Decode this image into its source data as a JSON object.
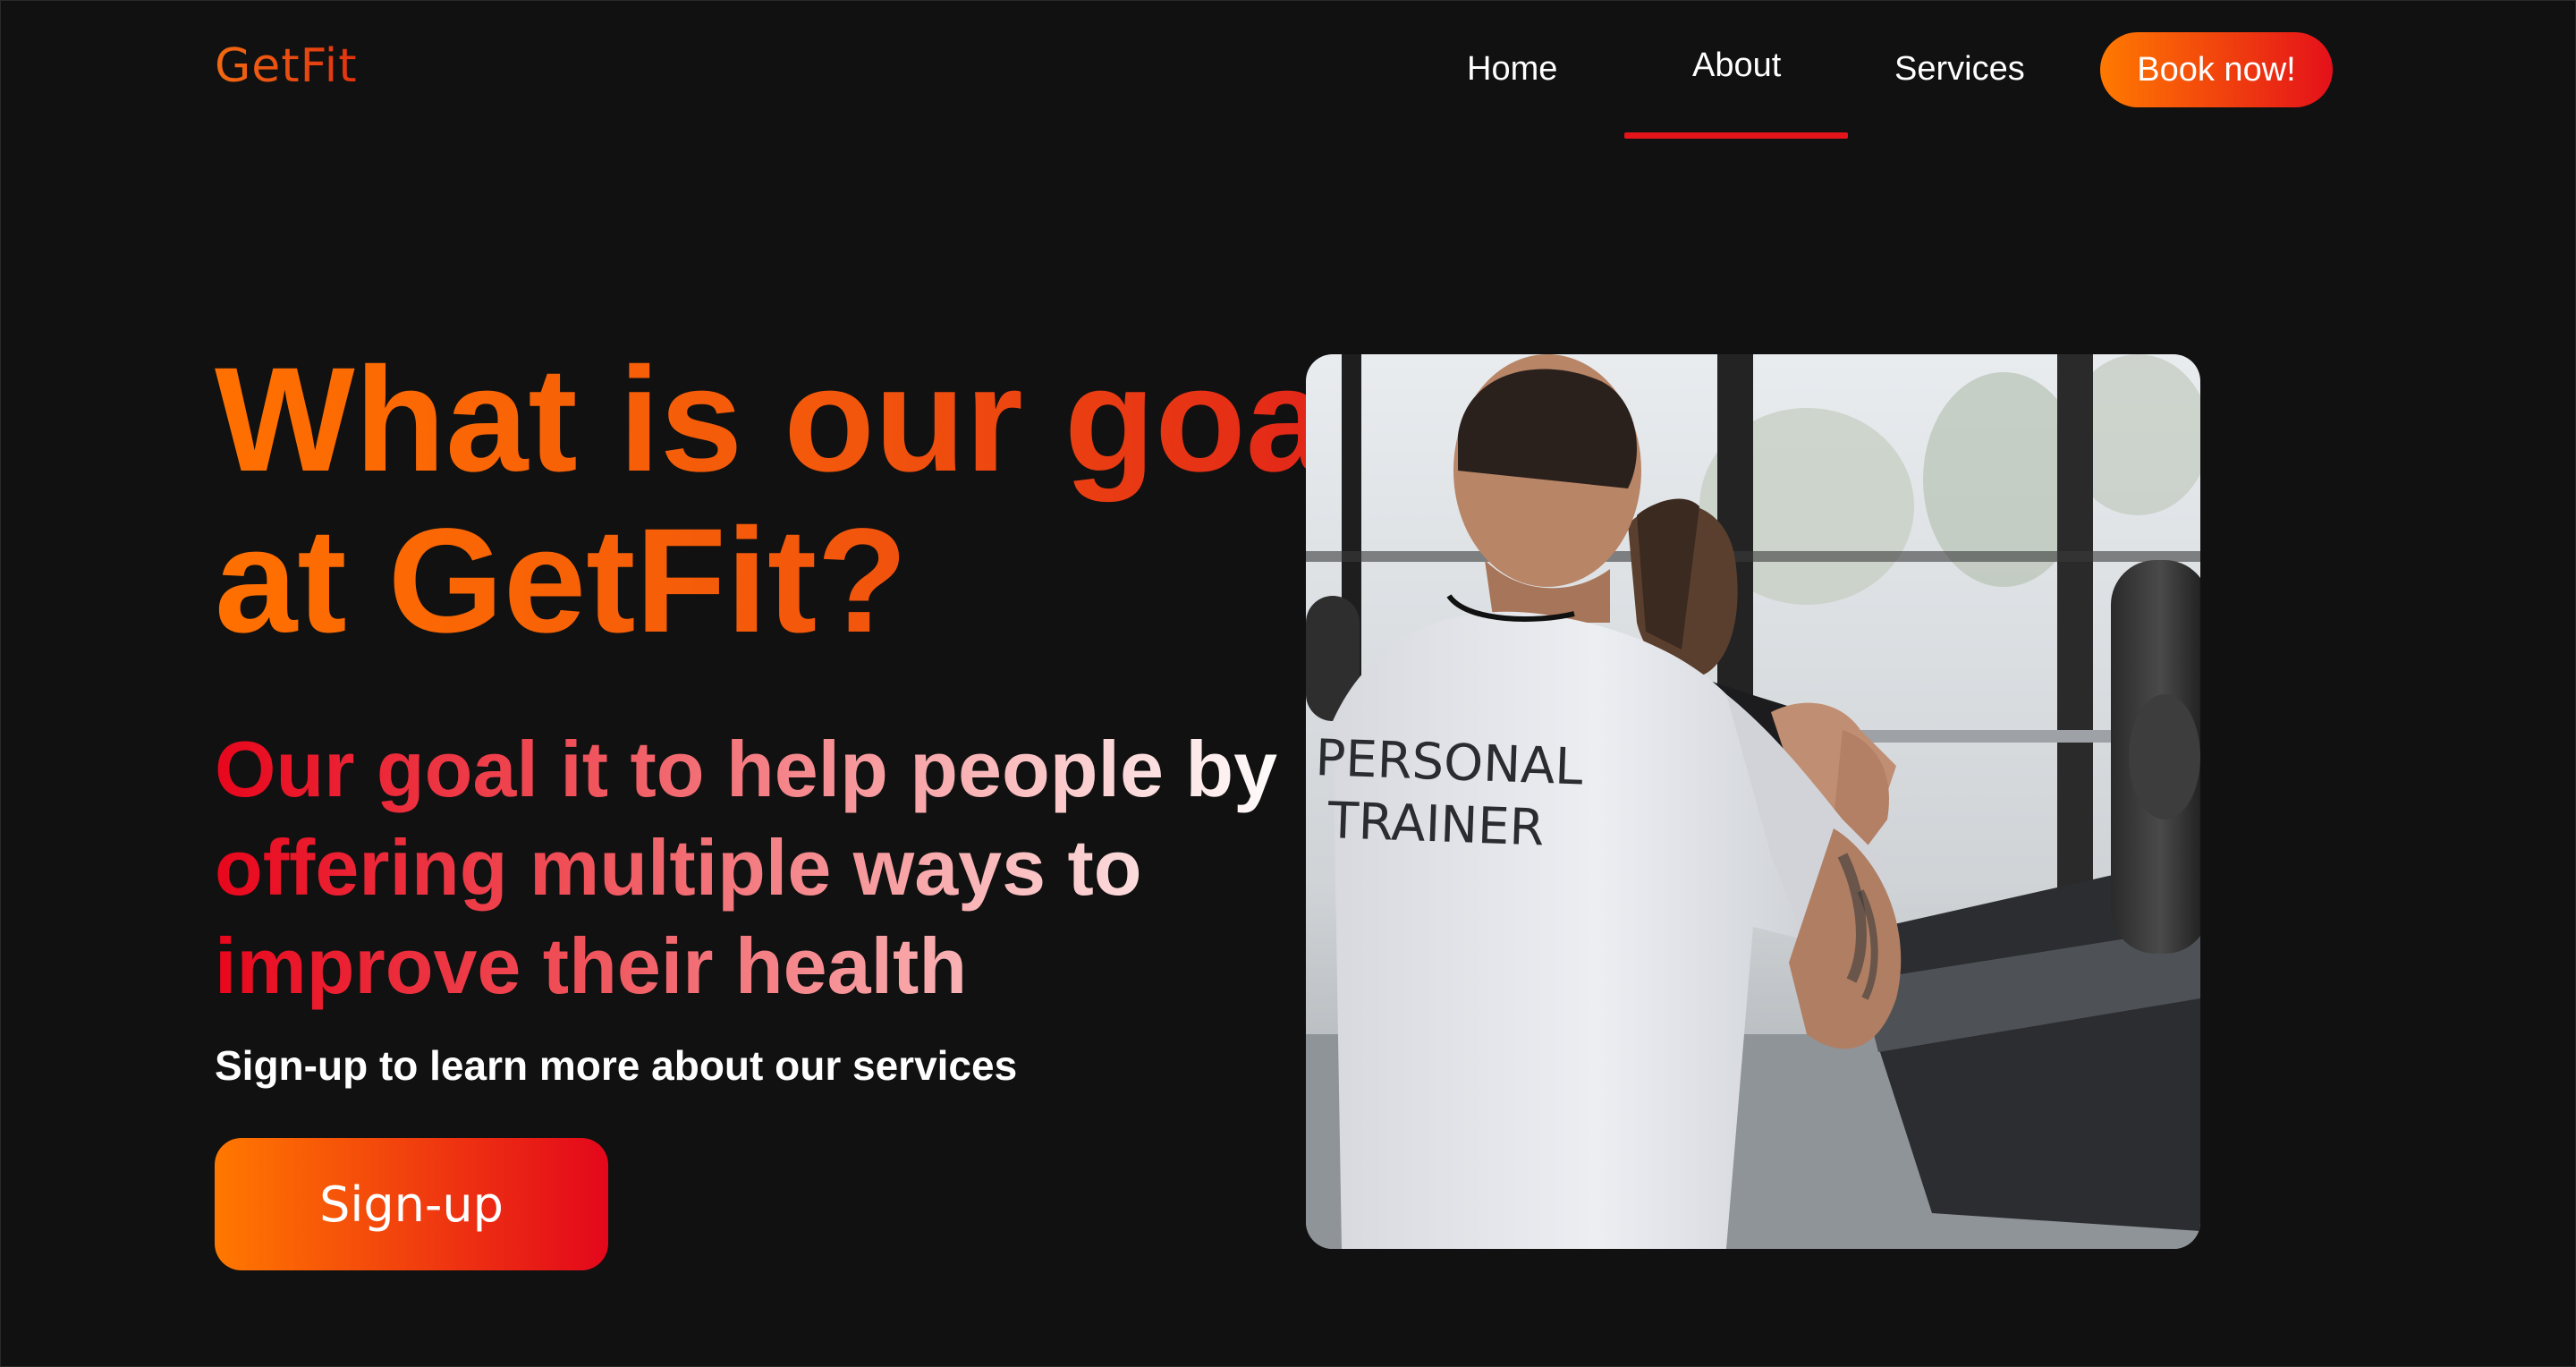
{
  "header": {
    "logo": "GetFit",
    "nav": [
      {
        "label": "Home"
      },
      {
        "label": "About"
      },
      {
        "label": "Services"
      }
    ],
    "active_nav": "About",
    "book_label": "Book now!"
  },
  "hero": {
    "title": "What is our goal at GetFit?",
    "subtitle": "Our goal it to help people by offering multiple ways to improve their health",
    "cta_text": "Sign-up to learn more about our services",
    "signup_label": "Sign-up",
    "image_shirt_text_line1": "PERSONAL",
    "image_shirt_text_line2": "TRAINER"
  },
  "colors": {
    "background": "#111111",
    "accent_orange": "#ff7000",
    "accent_red": "#e4101a",
    "nav_underline": "#e4141b"
  }
}
